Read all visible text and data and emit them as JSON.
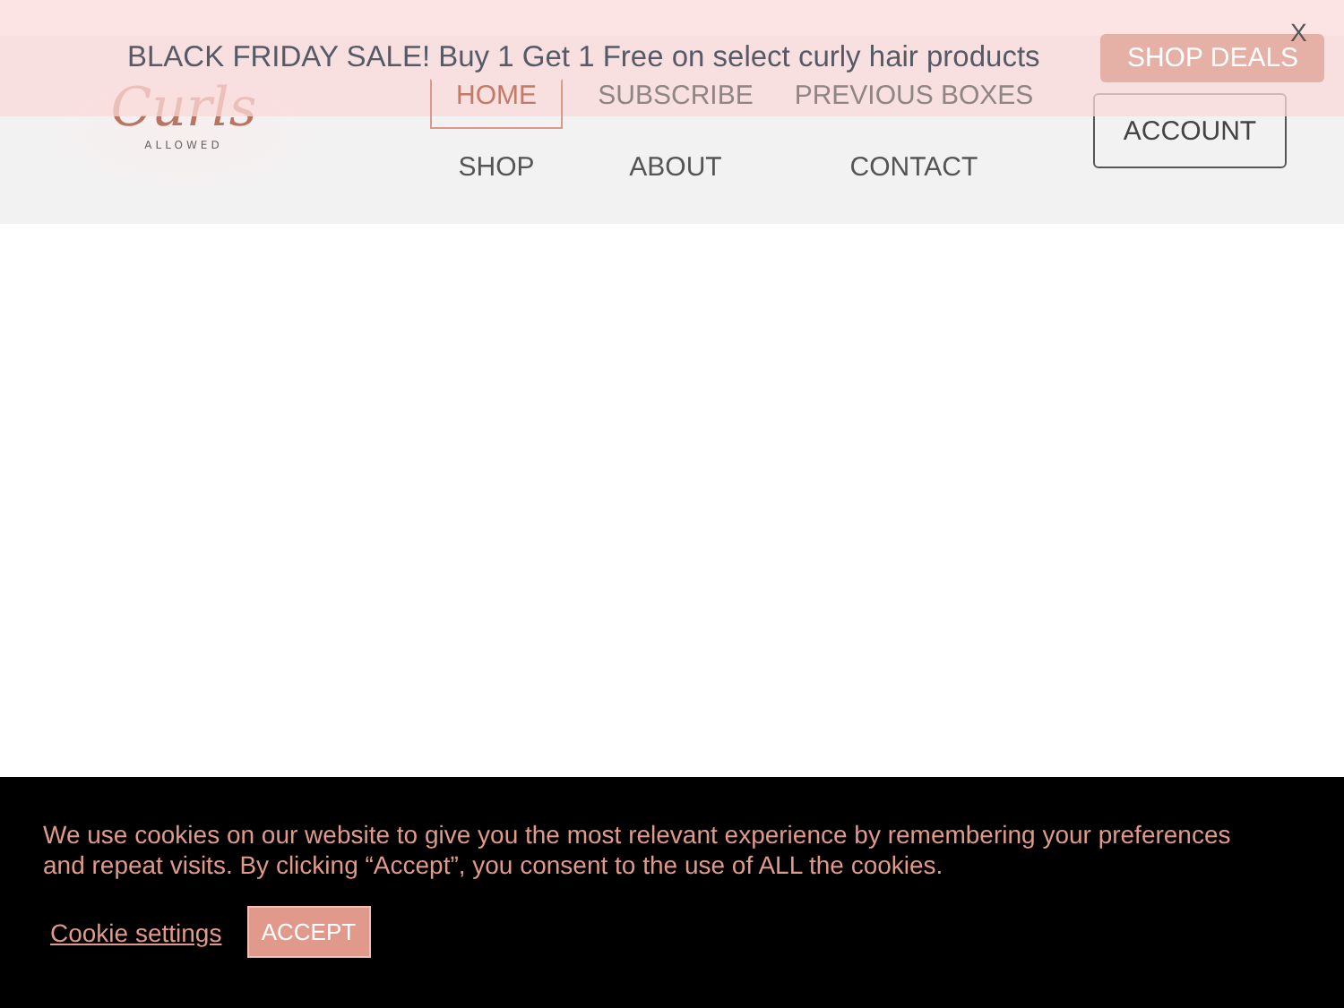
{
  "logo": {
    "name": "Curls",
    "tagline": "ALLOWED"
  },
  "nav": [
    {
      "label": "HOME",
      "selected": true
    },
    {
      "label": "SUBSCRIBE",
      "selected": false
    },
    {
      "label": "PREVIOUS BOXES",
      "selected": false
    },
    {
      "label": "SHOP",
      "selected": false
    },
    {
      "label": "ABOUT",
      "selected": false
    },
    {
      "label": "CONTACT",
      "selected": false
    }
  ],
  "account_button": "ACCOUNT",
  "promo_banner": {
    "text": "BLACK FRIDAY SALE! Buy 1 Get 1 Free on select curly hair products",
    "button": "SHOP DEALS",
    "close": "X"
  },
  "cookie_bar": {
    "text": "We use cookies on our website to give you the most relevant experience by remembering your preferences and repeat visits. By clicking “Accept”, you consent to the use of ALL the cookies.",
    "settings_link": "Cookie settings",
    "accept_button": "ACCEPT"
  }
}
